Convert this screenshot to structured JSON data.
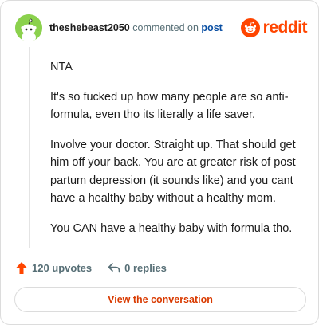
{
  "header": {
    "username": "theshebeast2050",
    "action_text": "commented on",
    "post_link": "post",
    "brand": "reddit",
    "avatar_icon": "snoo-avatar-icon",
    "logo_icon": "reddit-snoo-icon"
  },
  "comment": {
    "paragraphs": [
      "NTA",
      "It's so fucked up how many people are so anti-formula, even tho its literally a life saver.",
      "Involve your doctor. Straight up. That should get him off your back. You are at greater risk of post partum depression (it sounds like) and you cant have a healthy baby without a healthy mom.",
      "You CAN have a healthy baby with formula tho."
    ]
  },
  "actions": {
    "upvotes": "120 upvotes",
    "replies": "0 replies",
    "upvote_icon": "upvote-arrow-icon",
    "reply_icon": "reply-arrow-icon"
  },
  "button": {
    "label": "View the conversation"
  },
  "colors": {
    "brand": "#ff4500",
    "link": "#0a4fa3",
    "muted": "#576f76",
    "avatar": "#8bd14d",
    "button_text": "#d93a00"
  }
}
